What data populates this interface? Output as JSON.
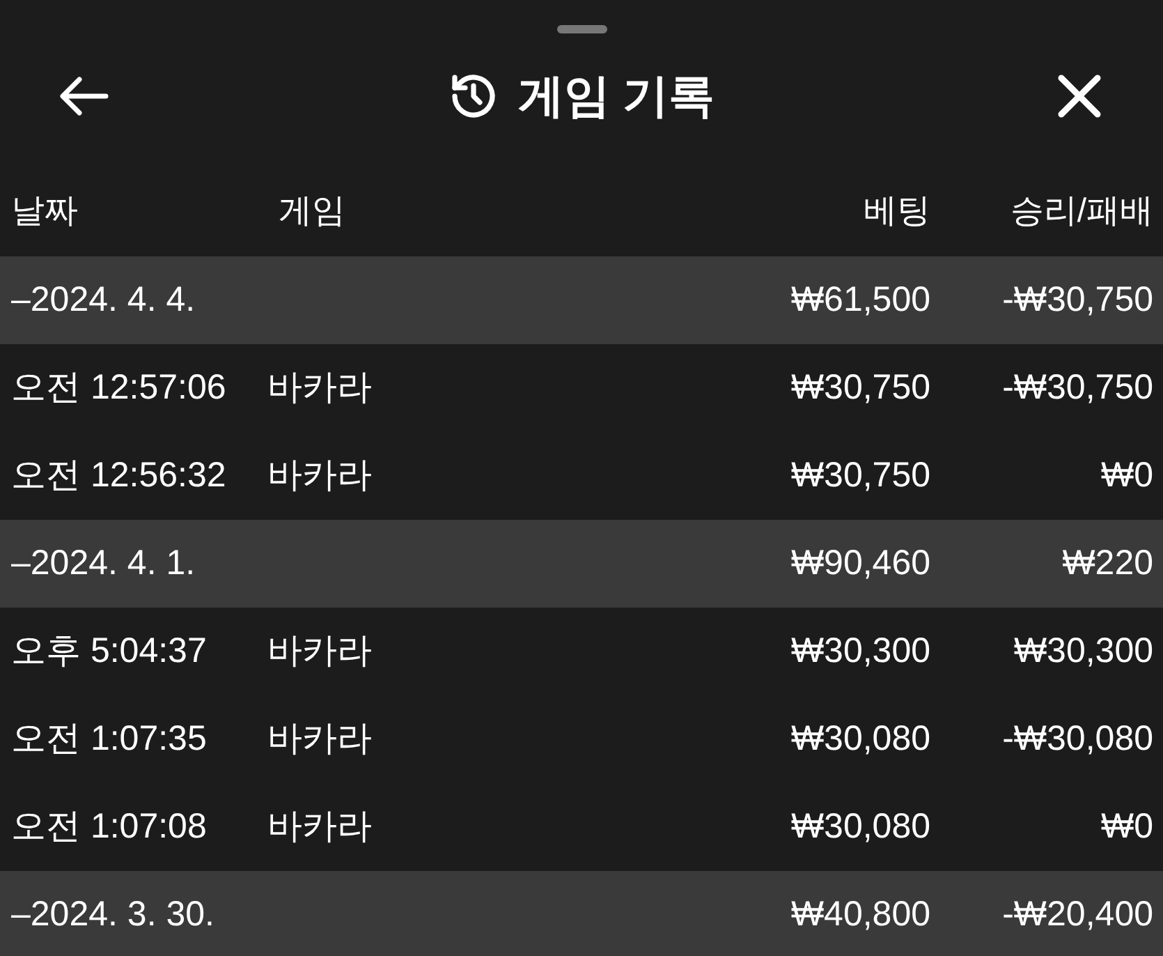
{
  "header": {
    "title": "게임 기록"
  },
  "columns": [
    "날짜",
    "게임",
    "베팅",
    "승리/패배"
  ],
  "groups": [
    {
      "date": "–2024. 4. 4.",
      "bet": "₩61,500",
      "result": "-₩30,750",
      "rows": [
        {
          "time": "오전 12:57:06",
          "game": "바카라",
          "bet": "₩30,750",
          "result": "-₩30,750"
        },
        {
          "time": "오전 12:56:32",
          "game": "바카라",
          "bet": "₩30,750",
          "result": "₩0"
        }
      ]
    },
    {
      "date": "–2024. 4. 1.",
      "bet": "₩90,460",
      "result": "₩220",
      "rows": [
        {
          "time": "오후 5:04:37",
          "game": "바카라",
          "bet": "₩30,300",
          "result": "₩30,300"
        },
        {
          "time": "오전 1:07:35",
          "game": "바카라",
          "bet": "₩30,080",
          "result": "-₩30,080"
        },
        {
          "time": "오전 1:07:08",
          "game": "바카라",
          "bet": "₩30,080",
          "result": "₩0"
        }
      ]
    },
    {
      "date": "–2024. 3. 30.",
      "bet": "₩40,800",
      "result": "-₩20,400"
    }
  ]
}
